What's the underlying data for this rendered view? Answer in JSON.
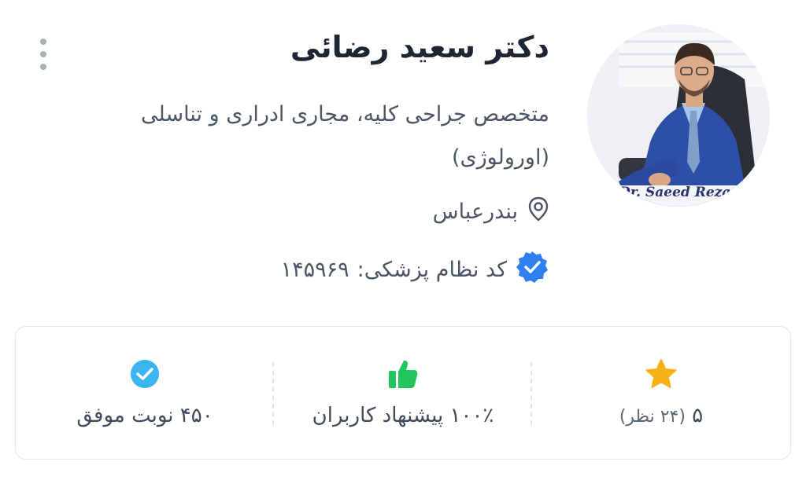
{
  "doctor": {
    "name": "دکتر سعید رضائی",
    "specialty": "متخصص جراحی کلیه، مجاری ادراری و تناسلی (اورولوژی)",
    "city": "بندرعباس",
    "medical_code_label": "کد نظام پزشکی:",
    "medical_code": "۱۴۵۹۶۹",
    "photo_caption": "Dr. Saeed Rezaei"
  },
  "stats": {
    "rating_value": "۵",
    "rating_reviews": "(۲۴ نظر)",
    "recommend": "۱۰۰٪ پیشنهاد کاربران",
    "appointments": "۴۵۰ نوبت موفق"
  },
  "colors": {
    "star": "#f7b21a",
    "thumb": "#22c55e",
    "check": "#3ab5f0",
    "verified": "#2e7ff0"
  }
}
